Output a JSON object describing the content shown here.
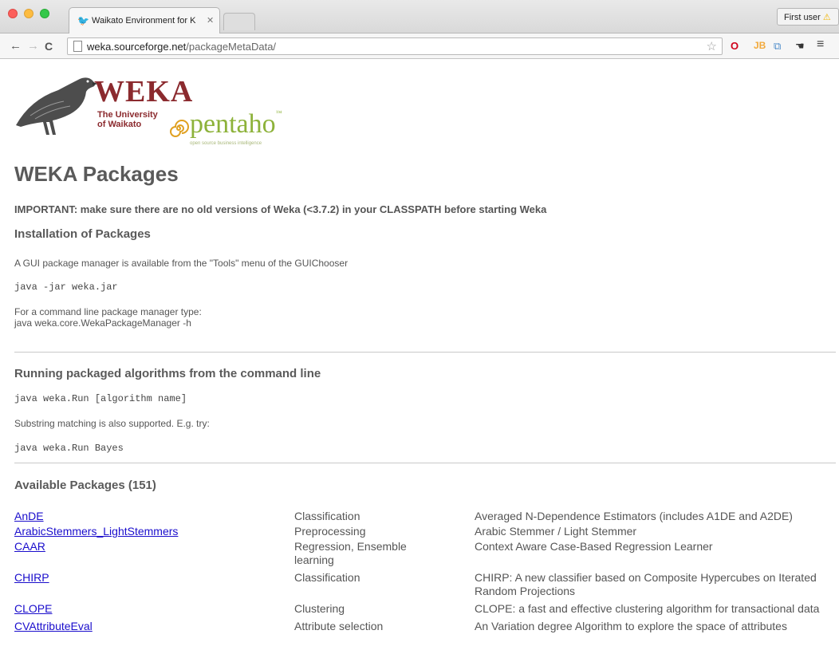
{
  "browser": {
    "tab_title": "Waikato Environment for K",
    "profile_label": "First user",
    "url_host": "weka.sourceforge.net",
    "url_path": "/packageMetaData/",
    "extensions": [
      "O",
      "JB",
      "⧉",
      "☚"
    ]
  },
  "logo": {
    "weka": "WEKA",
    "university_line1": "The University",
    "university_line2": "of Waikato",
    "pentaho": "pentaho",
    "pentaho_tagline": "open source business intelligence"
  },
  "page": {
    "title": "WEKA Packages",
    "important": "IMPORTANT: make sure there are no old versions of Weka (<3.7.2) in your CLASSPATH before starting Weka",
    "install_heading": "Installation of Packages",
    "install_text": "A GUI package manager is available from the \"Tools\" menu of the GUIChooser",
    "install_code": "java -jar weka.jar",
    "cmdline_text_1": "For a command line package manager type:",
    "cmdline_text_2": "java weka.core.WekaPackageManager -h",
    "running_heading": "Running packaged algorithms from the command line",
    "running_code": "java weka.Run [algorithm name]",
    "substring_text": "Substring matching is also supported. E.g. try:",
    "bayes_code": "java weka.Run Bayes",
    "available_heading": "Available Packages (151)"
  },
  "packages": [
    {
      "name": "AnDE",
      "category": "Classification",
      "description": "Averaged N-Dependence Estimators (includes A1DE and A2DE)"
    },
    {
      "name": "ArabicStemmers_LightStemmers",
      "category": "Preprocessing",
      "description": "Arabic Stemmer / Light Stemmer"
    },
    {
      "name": "CAAR",
      "category": "Regression, Ensemble learning",
      "description": "Context Aware Case-Based Regression Learner"
    },
    {
      "name": "CHIRP",
      "category": "Classification",
      "description": "CHIRP: A new classifier based on Composite Hypercubes on Iterated Random Projections"
    },
    {
      "name": "CLOPE",
      "category": "Clustering",
      "description": "CLOPE: a fast and effective clustering algorithm for transactional data"
    },
    {
      "name": "CVAttributeEval",
      "category": "Attribute selection",
      "description": "An Variation degree Algorithm to explore the space of attributes"
    }
  ]
}
